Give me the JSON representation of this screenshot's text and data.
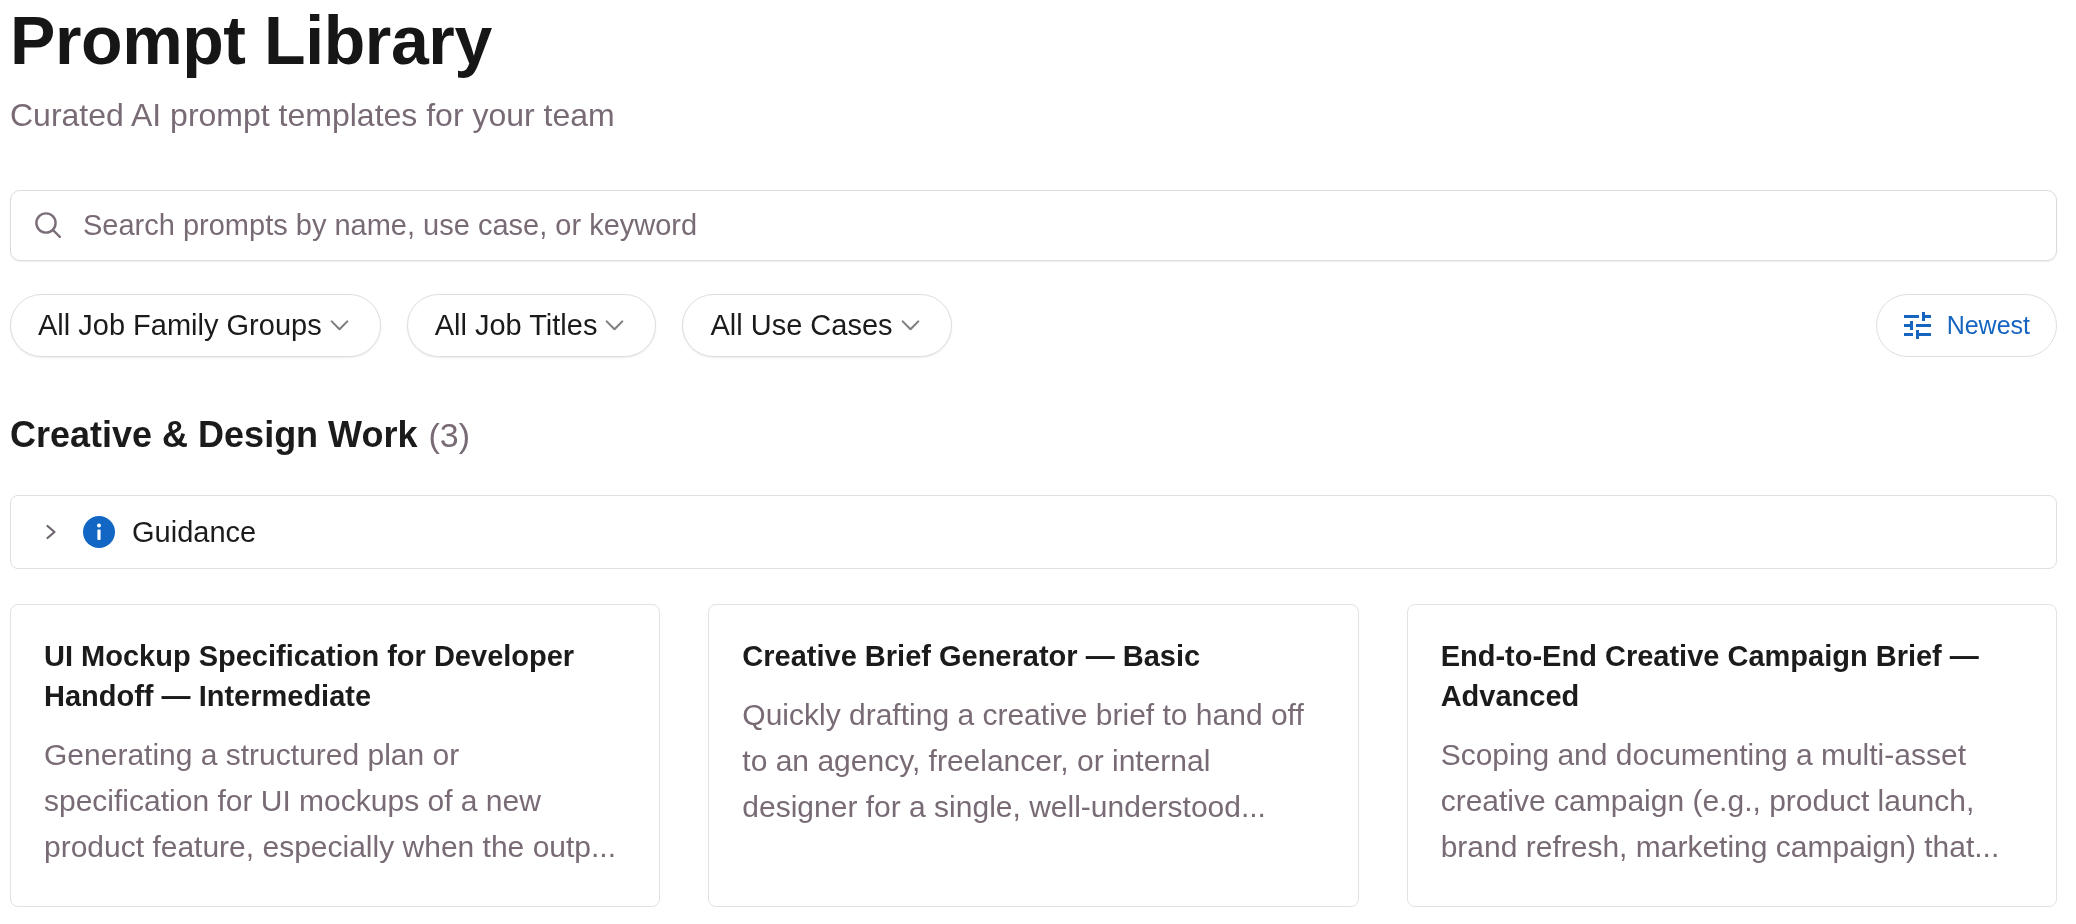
{
  "header": {
    "title": "Prompt Library",
    "subtitle": "Curated AI prompt templates for your team"
  },
  "search": {
    "placeholder": "Search prompts by name, use case, or keyword"
  },
  "filters": [
    {
      "label": "All Job Family Groups"
    },
    {
      "label": "All Job Titles"
    },
    {
      "label": "All Use Cases"
    }
  ],
  "sort_button": {
    "label": "Newest"
  },
  "section": {
    "title": "Creative & Design Work",
    "count": "(3)",
    "guidance": {
      "label": "Guidance",
      "expanded": false
    },
    "cards": [
      {
        "title": "UI Mockup Specification for Developer Handoff — Intermediate",
        "description": "Generating a structured plan or specification for UI mockups of a new product feature, especially when the outp..."
      },
      {
        "title": "Creative Brief Generator — Basic",
        "description": "Quickly drafting a creative brief to hand off to an agency, freelancer, or internal designer for a single, well-understood..."
      },
      {
        "title": "End-to-End Creative Campaign Brief — Advanced",
        "description": "Scoping and documenting a multi-asset creative campaign (e.g., product launch, brand refresh, marketing campaign) that..."
      }
    ]
  }
}
